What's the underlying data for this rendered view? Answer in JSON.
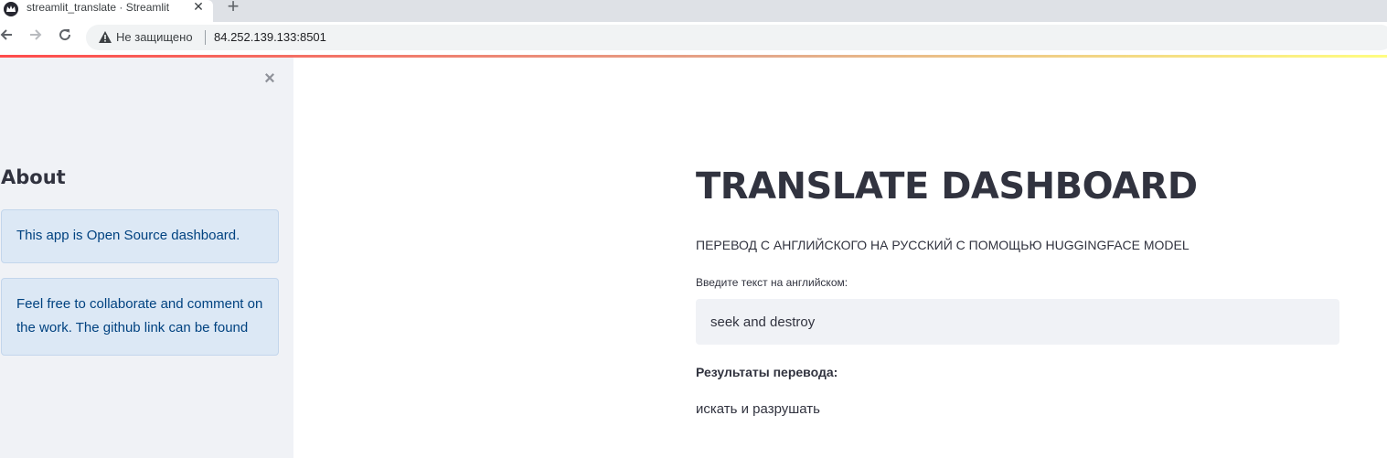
{
  "browser": {
    "tab_title": "streamlit_translate · Streamlit",
    "tab_close": "✕",
    "new_tab": "+",
    "insecure_label": "Не защищено",
    "url": "84.252.139.133:8501",
    "icons": {
      "favicon": "streamlit-crown-icon",
      "back": "arrow-left-icon",
      "forward": "arrow-right-icon",
      "reload": "reload-icon",
      "warning": "warning-triangle-icon"
    }
  },
  "sidebar": {
    "close": "×",
    "heading": "About",
    "info": [
      "This app is Open Source dashboard.",
      "Feel free to collaborate and comment on the work. The github link can be found"
    ]
  },
  "main": {
    "title": "TRANSLATE DASHBOARD",
    "subtitle": "ПЕРЕВОД С АНГЛИЙСКОГО НА РУССКИЙ С ПОМОЩЬЮ HUGGINGFACE MODEL",
    "input_label": "Введите текст на английском:",
    "input_value": "seek and destroy",
    "results_label": "Результаты перевода:",
    "results_text": "искать и разрушать"
  },
  "colors": {
    "accent": "#ff4b4b",
    "sidebar_bg": "#f0f2f6",
    "info_bg": "#dce8f5",
    "info_text": "#004280",
    "text": "#31333f"
  }
}
